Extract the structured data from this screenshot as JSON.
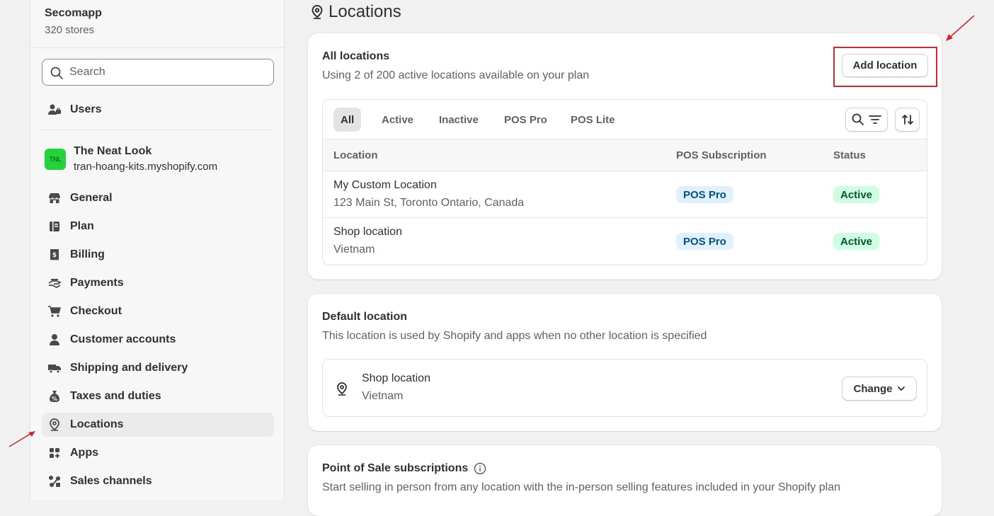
{
  "sidebar": {
    "org_name": "Secomapp",
    "org_stores": "320 stores",
    "search_placeholder": "Search",
    "users_label": "Users",
    "store": {
      "avatar_text": "TNL",
      "name": "The Neat Look",
      "domain": "tran-hoang-kits.myshopify.com"
    },
    "items": [
      {
        "label": "General",
        "icon": "store-icon"
      },
      {
        "label": "Plan",
        "icon": "plan-icon"
      },
      {
        "label": "Billing",
        "icon": "billing-icon"
      },
      {
        "label": "Payments",
        "icon": "payments-icon"
      },
      {
        "label": "Checkout",
        "icon": "cart-icon"
      },
      {
        "label": "Customer accounts",
        "icon": "person-icon"
      },
      {
        "label": "Shipping and delivery",
        "icon": "truck-icon"
      },
      {
        "label": "Taxes and duties",
        "icon": "tax-icon"
      },
      {
        "label": "Locations",
        "icon": "location-icon",
        "active": true
      },
      {
        "label": "Apps",
        "icon": "apps-icon"
      },
      {
        "label": "Sales channels",
        "icon": "sales-channels-icon"
      }
    ]
  },
  "page": {
    "title": "Locations"
  },
  "all_locations": {
    "title": "All locations",
    "subtitle": "Using 2 of 200 active locations available on your plan",
    "add_button": "Add location",
    "tabs": [
      "All",
      "Active",
      "Inactive",
      "POS Pro",
      "POS Lite"
    ],
    "columns": [
      "Location",
      "POS Subscription",
      "Status"
    ],
    "rows": [
      {
        "name": "My Custom Location",
        "address": "123 Main St, Toronto Ontario, Canada",
        "pos": "POS Pro",
        "status": "Active"
      },
      {
        "name": "Shop location",
        "address": "Vietnam",
        "pos": "POS Pro",
        "status": "Active"
      }
    ]
  },
  "default_location": {
    "title": "Default location",
    "subtitle": "This location is used by Shopify and apps when no other location is specified",
    "location_name": "Shop location",
    "location_country": "Vietnam",
    "change_button": "Change"
  },
  "pos_subscriptions": {
    "title": "Point of Sale subscriptions",
    "subtitle": "Start selling in person from any location with the in-person selling features included in your Shopify plan"
  },
  "colors": {
    "highlight": "#d4262f",
    "active_badge": "#cdfee1",
    "pos_badge": "#e0f0ff",
    "store_avatar": "#22d33b"
  }
}
